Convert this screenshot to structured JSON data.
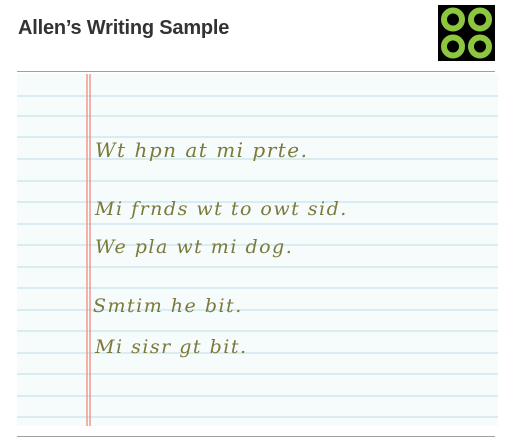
{
  "header": {
    "title": "Allen’s Writing Sample"
  },
  "logo": {
    "icon": "four-rings-logo",
    "colors": {
      "background": "#000000",
      "ring": "#8dc63f",
      "center": "#ffffff"
    }
  },
  "paper": {
    "rule_color": "#b9dde6",
    "margin_color": "#f08a7a",
    "ink_color": "#7c7a3a",
    "sentences": [
      "Wt hpn at mi prte.",
      "Mi frnds wt to owt sid.",
      "We pla wt mi dog.",
      "Smtim he bit.",
      "Mi sisr gt bit."
    ]
  }
}
